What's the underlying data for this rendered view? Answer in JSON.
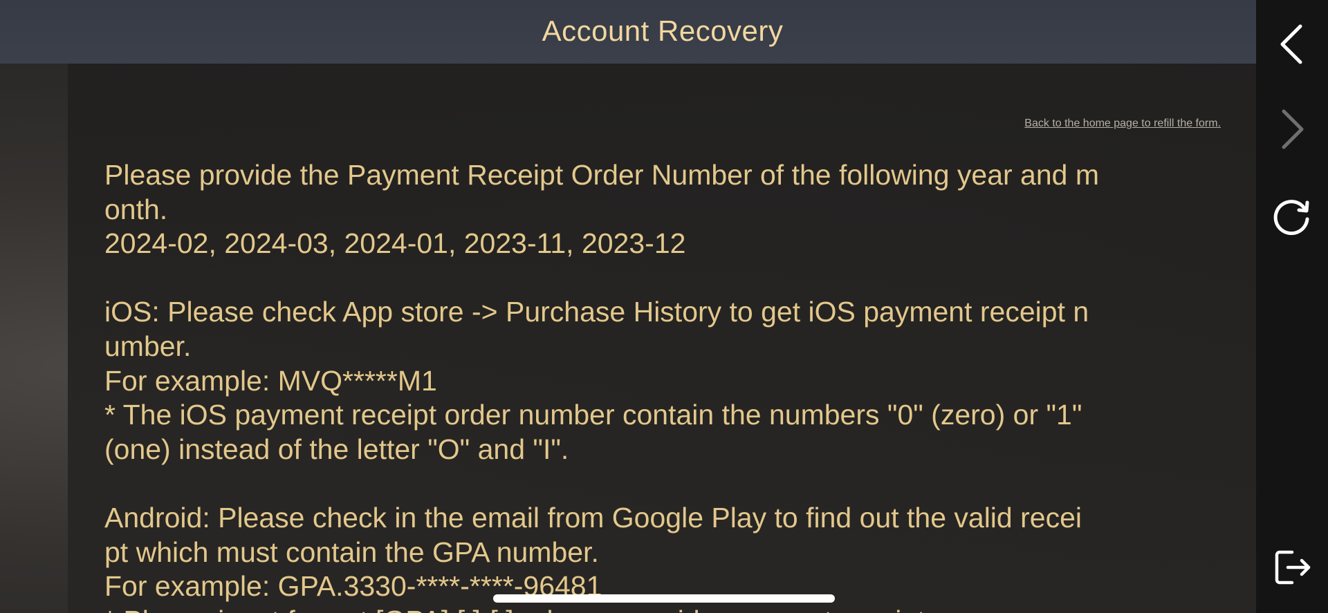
{
  "header": {
    "title": "Account Recovery"
  },
  "content": {
    "back_link": "Back to the home page to refill the form.",
    "lines": [
      "Please provide the Payment Receipt Order Number of the following year and m",
      "onth.",
      "2024-02, 2024-03, 2024-01, 2023-11, 2023-12",
      "",
      "iOS: Please check App store -> Purchase History to get iOS payment receipt n",
      "umber.",
      "For example: MVQ*****M1",
      "* The iOS payment receipt order number contain the numbers \"0\" (zero) or \"1\"",
      "(one) instead of the letter \"O\" and \"I\".",
      "",
      "Android: Please check in the email from Google Play to find out the valid recei",
      "pt which must contain the GPA number.",
      "For example: GPA.3330-****-****-96481",
      "* Please input format [GPA].[ ]-[ ]- please provide payment receipt or"
    ]
  },
  "sidebar": {
    "icons": [
      "back-arrow-icon",
      "forward-arrow-icon",
      "refresh-icon",
      "exit-icon"
    ]
  },
  "colors": {
    "accent_text": "#e3c88c",
    "title_text": "#f2d7a0",
    "header_bg": "#393e49",
    "sidebar_bg": "#141414",
    "link_text": "#b7b1a6"
  }
}
